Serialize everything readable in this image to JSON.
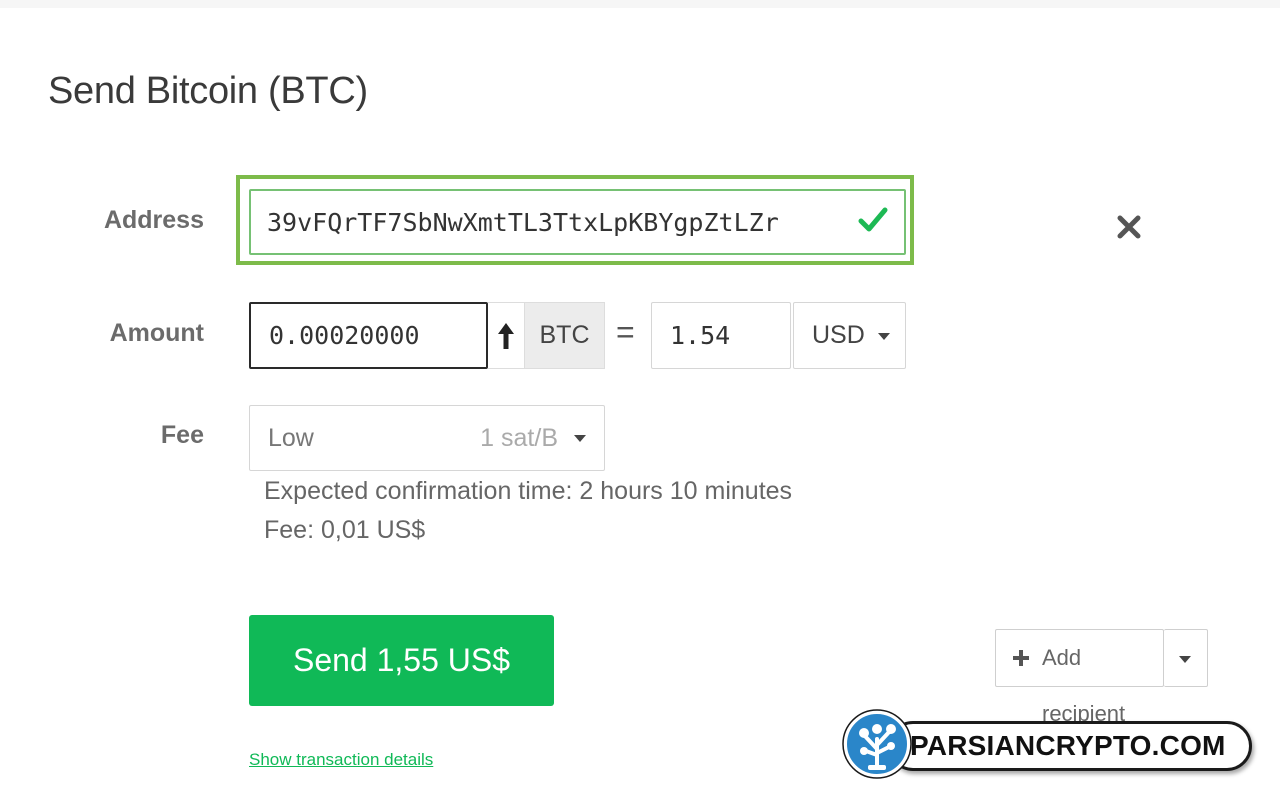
{
  "page": {
    "title": "Send Bitcoin (BTC)"
  },
  "form": {
    "address_label": "Address",
    "address_value": "39vFQrTF7SbNwXmtTL3TtxLpKBYgpZtLZr",
    "amount_label": "Amount",
    "amount_value": "0.00020000",
    "amount_unit": "BTC",
    "equals_sign": "=",
    "fiat_value": "1.54",
    "fiat_currency": "USD",
    "fee_label": "Fee",
    "fee_level": "Low",
    "fee_rate": "1 sat/B",
    "confirmation_time": "Expected confirmation time: 2 hours 10 minutes",
    "fee_cost": "Fee: 0,01 US$"
  },
  "actions": {
    "send_label": "Send 1,55 US$",
    "add_recipient_label": "Add recipient",
    "details_link": "Show transaction details"
  },
  "watermark": {
    "text": "PARSIANCRYPTO.COM"
  },
  "colors": {
    "accent_green": "#10b957",
    "valid_border": "#76c174",
    "highlight_outline": "#7dbb4a",
    "logo_blue": "#2a86c9"
  },
  "icons": {
    "address_valid": "check-icon",
    "remove": "close-icon",
    "swap": "arrow-up-icon",
    "add": "plus-icon",
    "dropdown": "chevron-down-icon"
  }
}
